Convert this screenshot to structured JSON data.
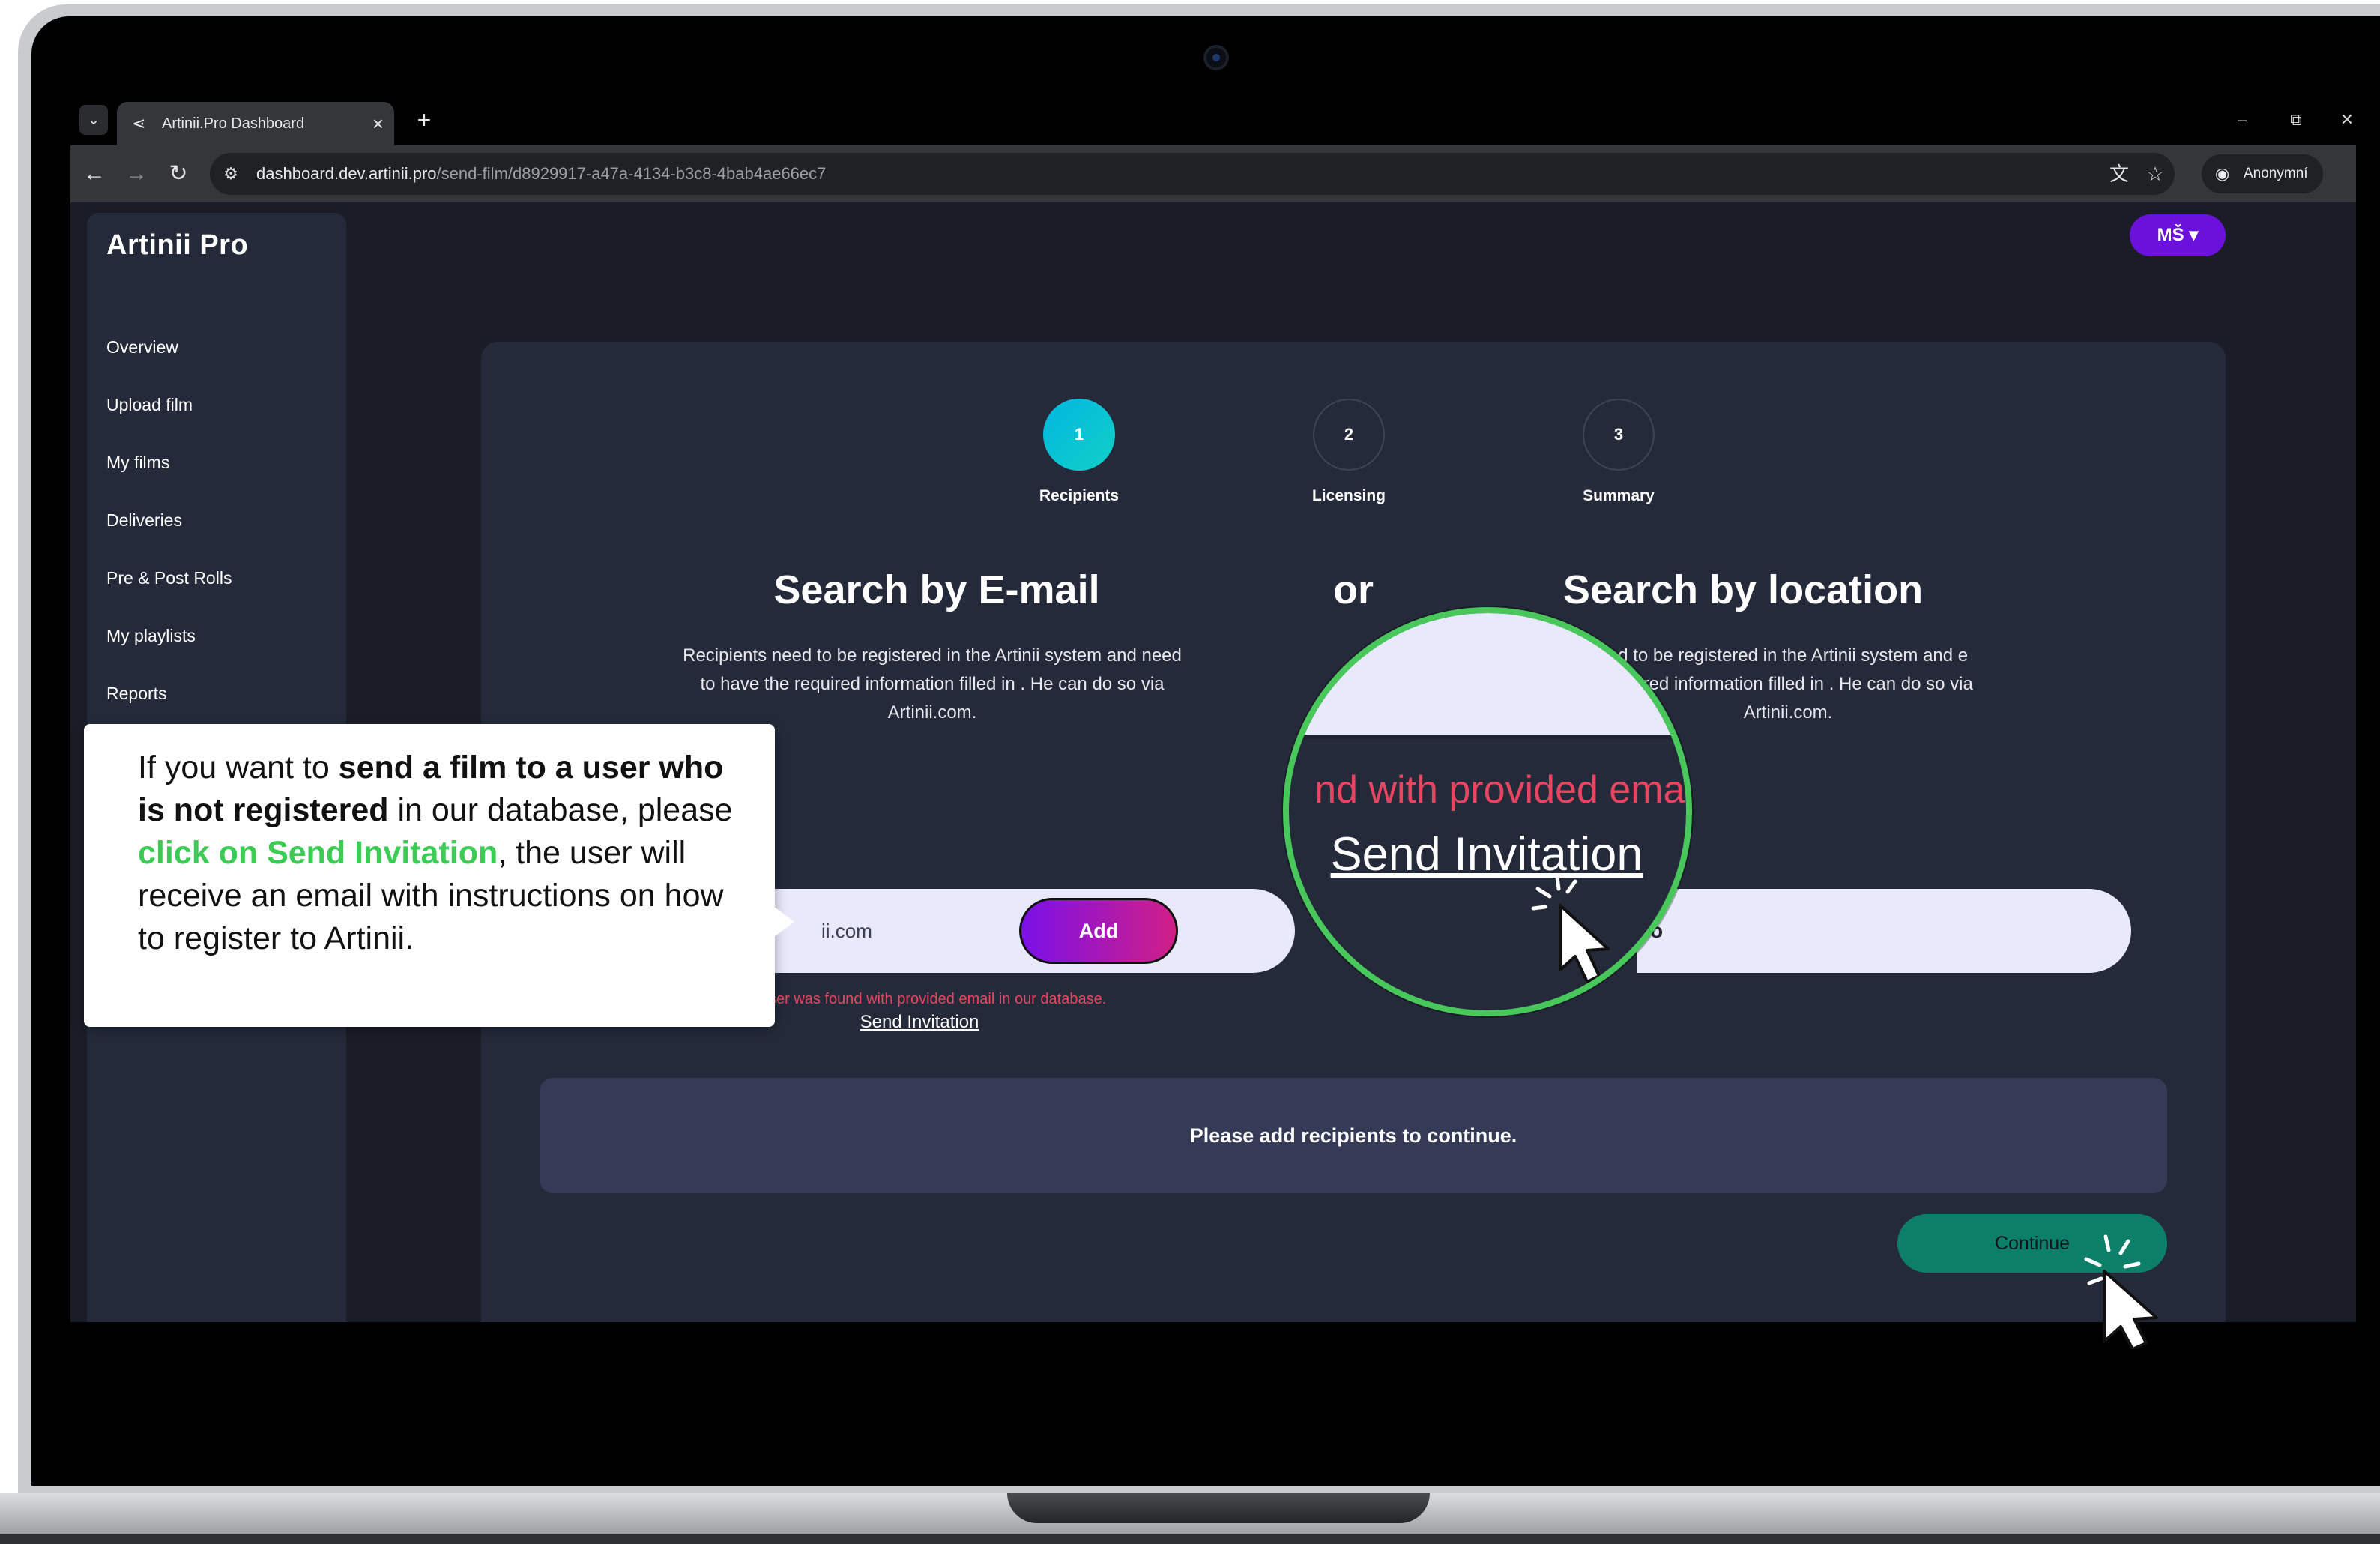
{
  "browser": {
    "tab_title": "Artinii.Pro Dashboard",
    "tab_close": "×",
    "new_tab": "+",
    "url_host": "dashboard.dev.artinii.pro",
    "url_path": "/send-film/d8929917-a47a-4134-b3c8-4bab4ae66ec7",
    "profile_label": "Anonymní",
    "minimize": "–",
    "restore": "⧉",
    "close": "✕"
  },
  "sidebar": {
    "logo": "Artinii Pro",
    "items": [
      {
        "label": "Overview"
      },
      {
        "label": "Upload film"
      },
      {
        "label": "My films"
      },
      {
        "label": "Deliveries"
      },
      {
        "label": "Pre & Post Rolls"
      },
      {
        "label": "My playlists"
      },
      {
        "label": "Reports"
      }
    ]
  },
  "header": {
    "user_initials": "MŠ"
  },
  "steps": [
    {
      "number": "1",
      "label": "Recipients",
      "active": true
    },
    {
      "number": "2",
      "label": "Licensing",
      "active": false
    },
    {
      "number": "3",
      "label": "Summary",
      "active": false
    }
  ],
  "search_email": {
    "title": "Search by E-mail",
    "description": "Recipients need to be registered in the Artinii system and need to have the required information filled in . He can do so via Artinii.com.",
    "input_value": "ii.com",
    "add_label": "Add",
    "error": "ser was found with provided email in our database.",
    "invite_label": "Send Invitation"
  },
  "or_label": "or",
  "search_location": {
    "title": "Search by location",
    "description": "ed to be registered in the Artinii system and e required information filled in . He can do so via Artinii.com.",
    "input_value": "o"
  },
  "notice": "Please add recipients to continue.",
  "continue_label": "Continue",
  "tooltip": {
    "part1": "If you want to ",
    "bold": "send a film to a user who is not registered",
    "part2": " in our database, please ",
    "green": "click on Send Invitation",
    "part3": ", the user will receive an email with instructions on how to register to Artinii."
  },
  "magnifier": {
    "error": "nd with provided emai",
    "link": "Send Invitation"
  },
  "colors": {
    "accent_purple": "#6a12dc",
    "step_active": "#11c4d8",
    "continue_green": "#0b7f68",
    "highlight_green": "#3ccb55",
    "error_red": "#e84561"
  }
}
